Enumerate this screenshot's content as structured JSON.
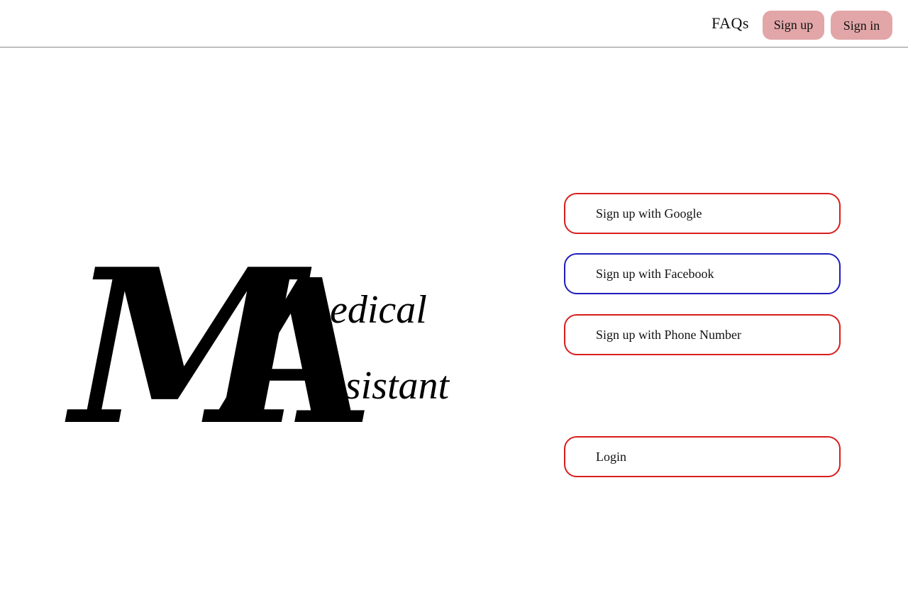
{
  "header": {
    "faq_label": "FAQs",
    "signup_label": "Sign up",
    "signin_label": "Sign in",
    "button_color": "#e2a6a8"
  },
  "logo": {
    "first_initial": "M",
    "first_rest": "edical",
    "second_initial": "A",
    "second_rest": "ssistant"
  },
  "auth": {
    "google_label": "Sign up with Google",
    "facebook_label": "Sign up with Facebook",
    "phone_label": "Sign up with Phone Number",
    "login_label": "Login",
    "red_border": "#d91d1d",
    "blue_border": "#1d1dbd"
  }
}
